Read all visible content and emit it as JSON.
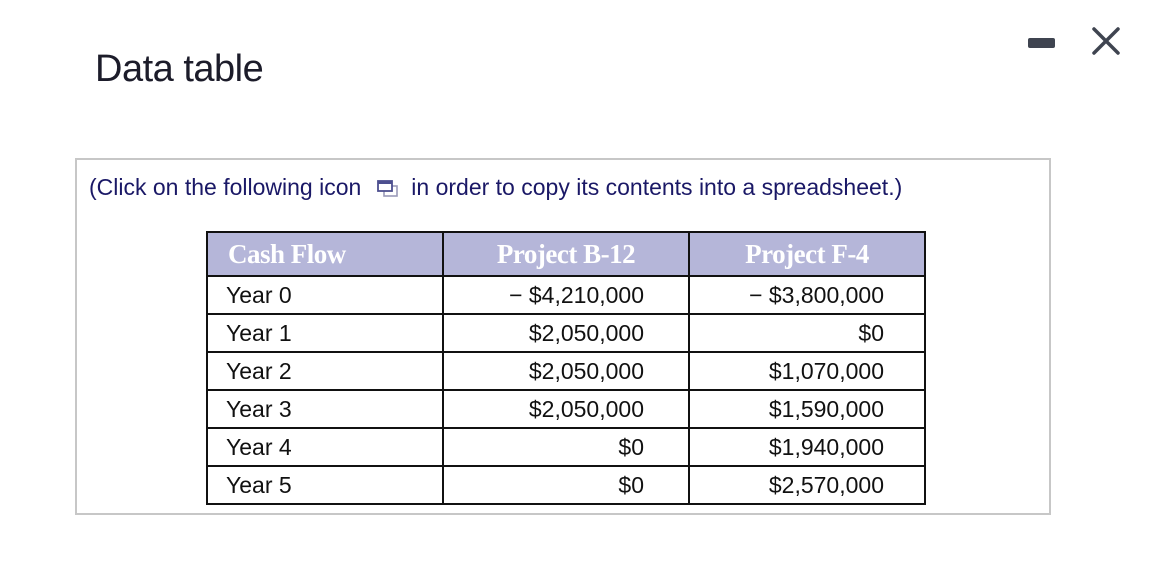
{
  "window": {
    "title": "Data table",
    "minimize_icon": "minimize-icon",
    "close_icon": "close-icon"
  },
  "instruction": {
    "prefix": "(Click on the following icon",
    "icon": "copy-to-spreadsheet-icon",
    "suffix": "in order to copy its contents into a spreadsheet.)"
  },
  "table": {
    "headers": [
      "Cash Flow",
      "Project B-12",
      "Project F-4"
    ],
    "rows": [
      {
        "label": "Year 0",
        "b12": "− $4,210,000",
        "f4": "− $3,800,000"
      },
      {
        "label": "Year 1",
        "b12": "$2,050,000",
        "f4": "$0"
      },
      {
        "label": "Year 2",
        "b12": "$2,050,000",
        "f4": "$1,070,000"
      },
      {
        "label": "Year 3",
        "b12": "$2,050,000",
        "f4": "$1,590,000"
      },
      {
        "label": "Year 4",
        "b12": "$0",
        "f4": "$1,940,000"
      },
      {
        "label": "Year 5",
        "b12": "$0",
        "f4": "$2,570,000"
      }
    ]
  },
  "colors": {
    "header_bg": "#b5b6d9",
    "instruction_text": "#1a1866",
    "title_text": "#1c1c2a"
  }
}
